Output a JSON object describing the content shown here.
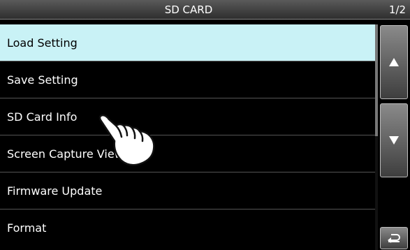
{
  "header": {
    "title": "SD CARD",
    "page_indicator": "1/2"
  },
  "menu": {
    "items": [
      {
        "label": "Load Setting",
        "selected": true
      },
      {
        "label": "Save Setting"
      },
      {
        "label": "SD Card Info"
      },
      {
        "label": "Screen Capture View"
      },
      {
        "label": "Firmware Update"
      },
      {
        "label": "Format"
      }
    ]
  },
  "side": {
    "up_icon": "triangle-up-icon",
    "down_icon": "triangle-down-icon",
    "back_icon": "return-arrow-icon"
  },
  "overlay": {
    "pointer_icon": "pointing-hand-icon"
  },
  "colors": {
    "selected_row": "#c9f2f6",
    "background": "#000000",
    "text": "#ffffff"
  }
}
